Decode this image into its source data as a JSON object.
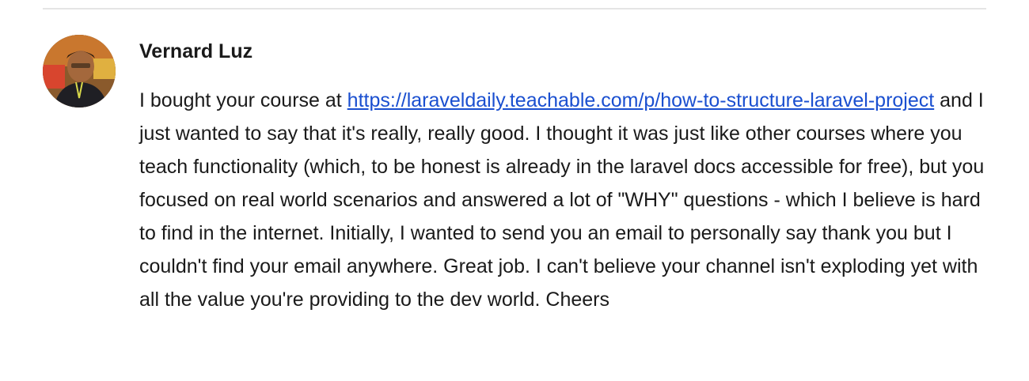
{
  "comment": {
    "author_name": "Vernard Luz",
    "text_before_link": "I bought your course at ",
    "link_text": "https://laraveldaily.teachable.com/p/how-to-structure-laravel-project",
    "text_after_link": " and I just wanted to say that it's really, really good. I thought it was just like other courses where you teach functionality (which, to be honest is already in the laravel docs accessible for free), but you focused on real world scenarios and answered a lot of \"WHY\" questions - which I believe is hard to find in the internet. Initially, I wanted to send you an email to personally say thank you but I couldn't find your email anywhere. Great job. I can't believe your channel isn't exploding yet with all the value you're providing to the dev world. Cheers",
    "link_color": "#1a4fd0"
  }
}
